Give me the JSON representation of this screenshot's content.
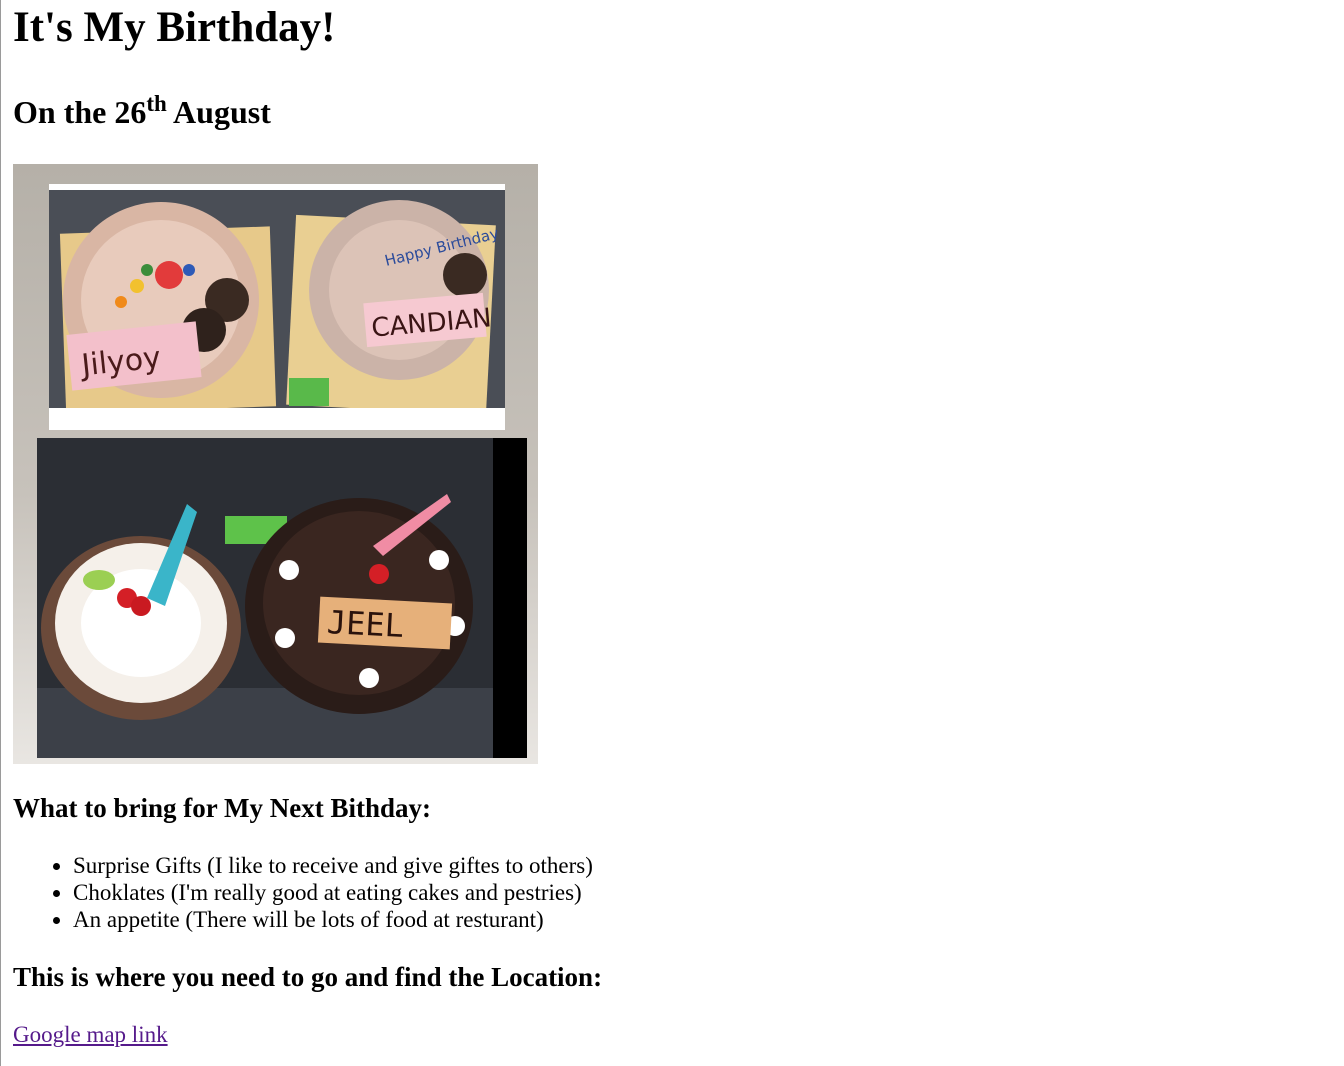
{
  "page": {
    "title": "It's My Birthday!",
    "date_prefix": "On the 26",
    "date_suffix": "th",
    "date_month": " August"
  },
  "photo": {
    "cake_labels": [
      "Jilyoy",
      "CANDIAN",
      "Happy Birthday",
      "JEEL"
    ]
  },
  "bring": {
    "heading": "What to bring for My Next Bithday:",
    "items": [
      "Surprise Gifts (I like to receive and give giftes to others)",
      "Choklates (I'm really good at eating cakes and pestries)",
      "An appetite (There will be lots of food at resturant)"
    ]
  },
  "location": {
    "heading": "This is where you need to go and find the Location:",
    "link_text": "Google map link"
  },
  "colors": {
    "link_visited": "#551a8b"
  }
}
